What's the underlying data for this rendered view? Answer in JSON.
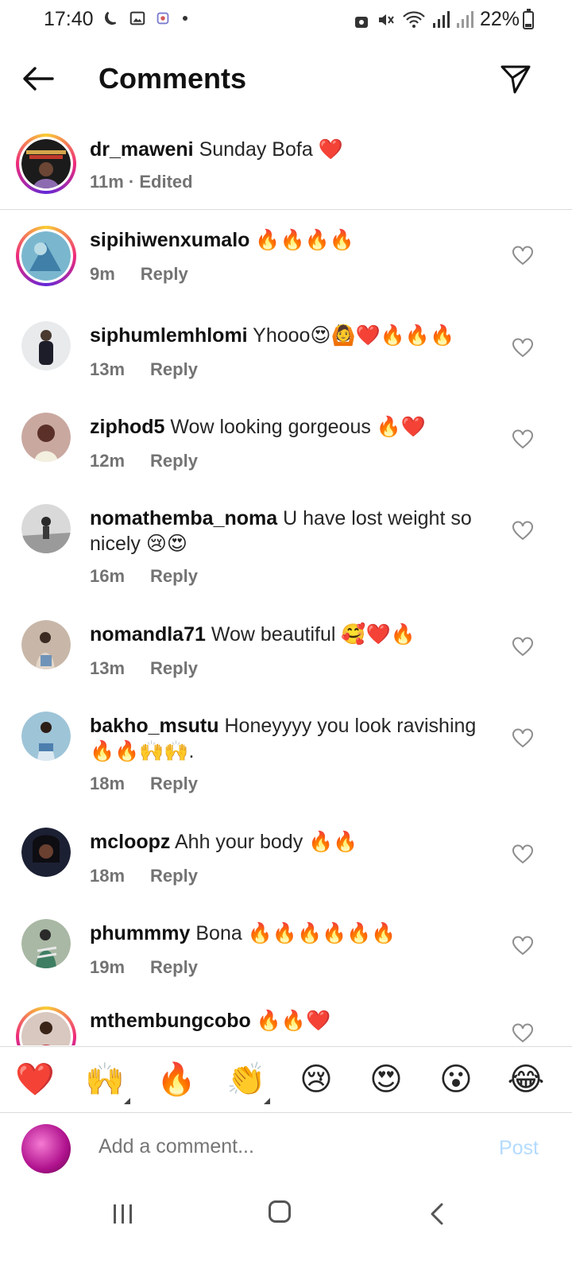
{
  "status_bar": {
    "time": "17:40",
    "battery": "22%",
    "battery_level": 0.22
  },
  "header": {
    "title": "Comments"
  },
  "caption": {
    "username": "dr_maweni",
    "text": "Sunday Bofa ❤️",
    "meta": "11m · Edited",
    "avatar_label": "USINGOMA FESTIVAL"
  },
  "comments": [
    {
      "username": "sipihiwenxumalo",
      "text": "🔥🔥🔥🔥",
      "time": "9m",
      "reply": "Reply"
    },
    {
      "username": "siphumlemhlomi",
      "text": "Yhooo😍🙆❤️🔥🔥🔥",
      "time": "13m",
      "reply": "Reply"
    },
    {
      "username": "ziphod5",
      "text": "Wow looking gorgeous 🔥❤️",
      "time": "12m",
      "reply": "Reply"
    },
    {
      "username": "nomathemba_noma",
      "text": "U have lost weight so nicely 😢😍",
      "time": "16m",
      "reply": "Reply"
    },
    {
      "username": "nomandla71",
      "text": "Wow beautiful 🥰❤️🔥",
      "time": "13m",
      "reply": "Reply"
    },
    {
      "username": "bakho_msutu",
      "text": "Honeyyyy you look ravishing 🔥🔥🙌🙌.",
      "time": "18m",
      "reply": "Reply"
    },
    {
      "username": "mcloopz",
      "text": "Ahh your body 🔥🔥",
      "time": "18m",
      "reply": "Reply"
    },
    {
      "username": "phummmy",
      "text": "Bona 🔥🔥🔥🔥🔥🔥",
      "time": "19m",
      "reply": "Reply"
    },
    {
      "username": "mthembungcobo",
      "text": "🔥🔥❤️",
      "time": "",
      "reply": ""
    }
  ],
  "emoji_bar": [
    "❤️",
    "🙌",
    "🔥",
    "👏",
    "😢",
    "😍",
    "😮",
    "😂"
  ],
  "add_comment": {
    "placeholder": "Add a comment...",
    "post_label": "Post"
  }
}
